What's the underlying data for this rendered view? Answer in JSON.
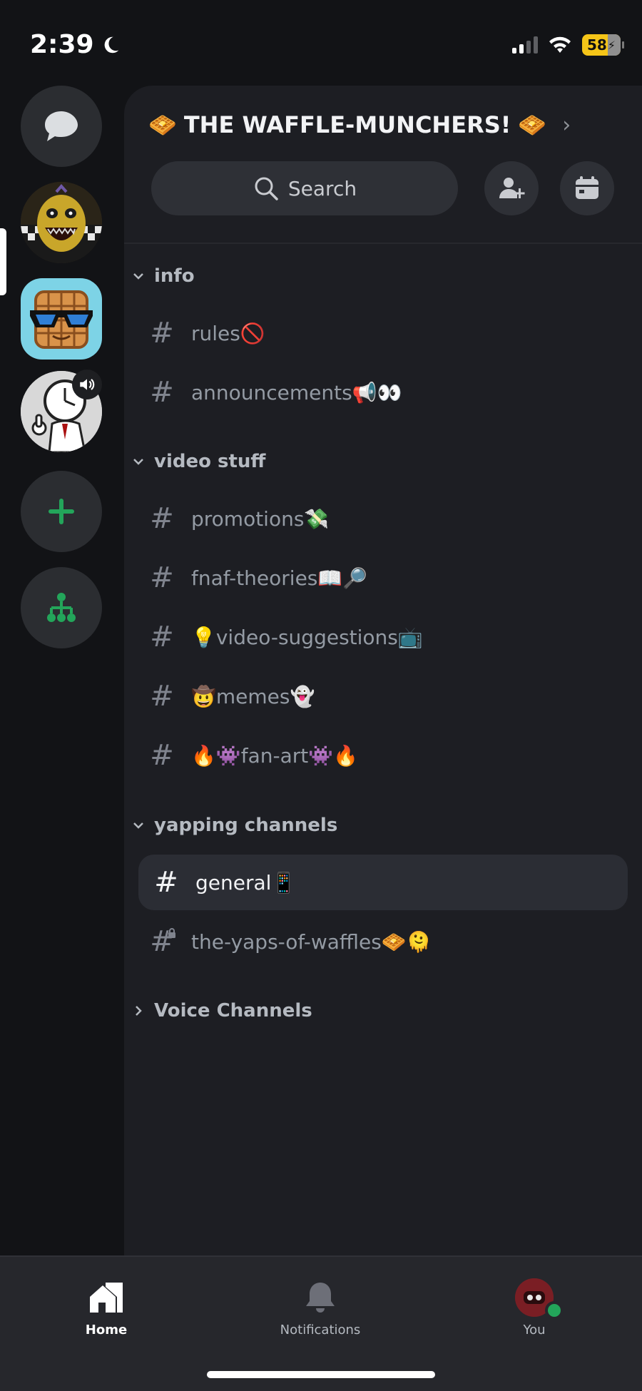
{
  "status_bar": {
    "time": "2:39",
    "battery_percent": "58"
  },
  "server_rail": {
    "items": [
      {
        "name": "Direct Messages"
      },
      {
        "name": "FNAF server"
      },
      {
        "name": "The Waffle-Munchers"
      },
      {
        "name": "Voice server"
      },
      {
        "name": "Add a Server"
      },
      {
        "name": "Discover"
      }
    ]
  },
  "server": {
    "title": "THE WAFFLE-MUNCHERS!",
    "title_emoji": "🧇",
    "chevron": "›"
  },
  "search": {
    "label": "Search"
  },
  "categories": [
    {
      "name": "info",
      "channels": [
        {
          "label": "rules🚫"
        },
        {
          "label": "announcements📢👀"
        }
      ]
    },
    {
      "name": "video stuff",
      "channels": [
        {
          "label": "promotions💸"
        },
        {
          "label": "fnaf-theories📖🔎"
        },
        {
          "label": "💡video-suggestions📺"
        },
        {
          "label": "🤠memes👻"
        },
        {
          "label": "🔥👾fan-art👾🔥"
        }
      ]
    },
    {
      "name": "yapping channels",
      "channels": [
        {
          "label": "general📱",
          "selected": true
        },
        {
          "label": "the-yaps-of-waffles🧇🫠",
          "locked": true
        }
      ]
    },
    {
      "name": "Voice Channels",
      "collapsed": true,
      "channels": []
    }
  ],
  "bottom_nav": {
    "home": "Home",
    "notifications": "Notifications",
    "you": "You"
  },
  "colors": {
    "background": "#121316",
    "panel": "#1d1e23",
    "accent_green": "#23a55a",
    "selected_row": "#2b2d34",
    "battery": "#f5c518"
  }
}
